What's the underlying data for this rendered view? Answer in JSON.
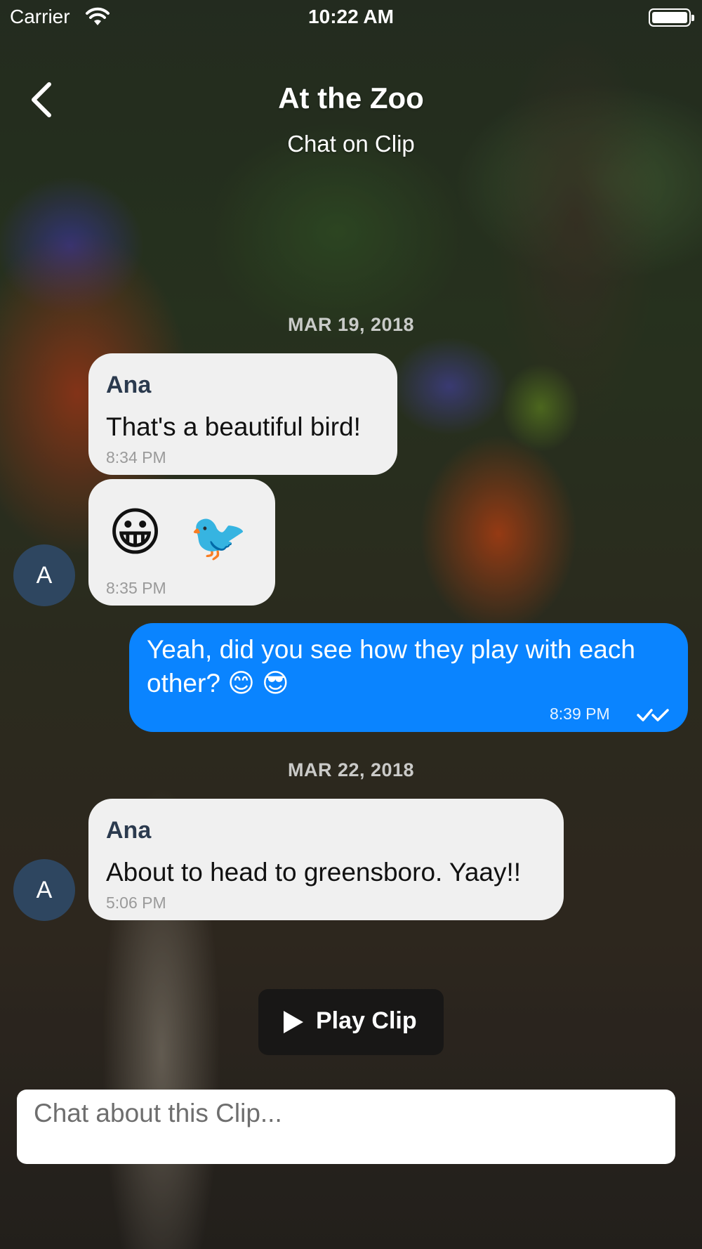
{
  "status_bar": {
    "carrier": "Carrier",
    "time": "10:22 AM"
  },
  "header": {
    "title": "At the Zoo",
    "subtitle": "Chat on Clip"
  },
  "dates": {
    "first": "MAR 19, 2018",
    "second": "MAR 22, 2018"
  },
  "messages": [
    {
      "sender": "Ana",
      "text": "That's a beautiful bird!",
      "time": "8:34 PM"
    },
    {
      "emojis": [
        "😀",
        "🐦"
      ],
      "time": "8:35 PM"
    },
    {
      "text_line1": "Yeah, did you see how they play with each",
      "text_line2": "other? 😊 😎",
      "time": "8:39 PM"
    },
    {
      "sender": "Ana",
      "text": "About to head to greensboro. Yaay!!",
      "time": "5:06 PM"
    }
  ],
  "avatar_initial": "A",
  "play_button": {
    "label": "Play Clip"
  },
  "input": {
    "placeholder": "Chat about this Clip..."
  },
  "colors": {
    "outgoing_bubble": "#0a84ff",
    "incoming_bubble": "#f0f0f0",
    "avatar": "#2e4660",
    "sender_name": "#2b3a4e"
  }
}
